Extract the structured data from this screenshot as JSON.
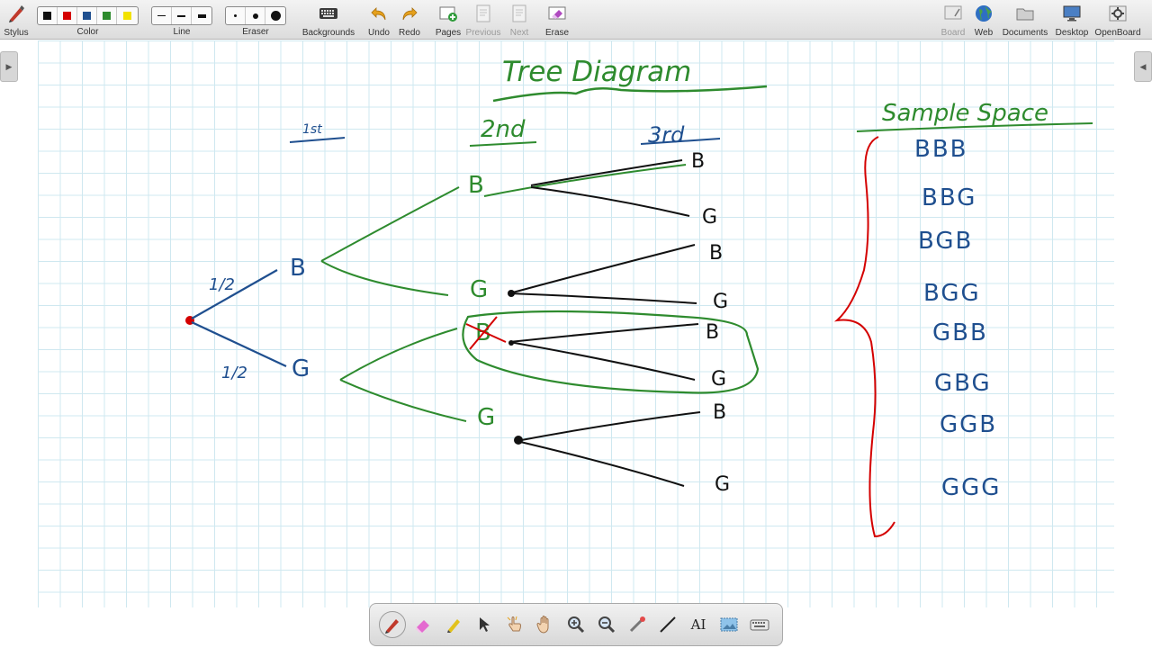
{
  "toolbar": {
    "stylus_label": "Stylus",
    "color_label": "Color",
    "colors": [
      "#111111",
      "#d40000",
      "#1f4f8f",
      "#2e8b2e",
      "#f2e200"
    ],
    "line_label": "Line",
    "eraser_label": "Eraser",
    "backgrounds_label": "Backgrounds",
    "undo_label": "Undo",
    "redo_label": "Redo",
    "pages_label": "Pages",
    "previous_label": "Previous",
    "next_label": "Next",
    "erase_label": "Erase",
    "board_label": "Board",
    "web_label": "Web",
    "documents_label": "Documents",
    "desktop_label": "Desktop",
    "openboard_label": "OpenBoard"
  },
  "board": {
    "title": "Tree Diagram",
    "col1": "1st",
    "col2": "2nd",
    "col3": "3rd",
    "prob_b": "1/2",
    "prob_g": "1/2",
    "level1": [
      "B",
      "G"
    ],
    "level2": [
      "B",
      "G",
      "B",
      "G"
    ],
    "level3": [
      "B",
      "G",
      "B",
      "G",
      "B",
      "G",
      "B",
      "G"
    ],
    "sample_space_title": "Sample Space",
    "sample_space": [
      "BBB",
      "BBG",
      "BGB",
      "BGG",
      "GBB",
      "GBG",
      "GGB",
      "GGG"
    ],
    "ink": {
      "blue": "#1f4f8f",
      "green": "#2e8b2e",
      "red": "#d40000",
      "black": "#111111"
    }
  },
  "palette": {
    "text_tool_label": "AI"
  }
}
